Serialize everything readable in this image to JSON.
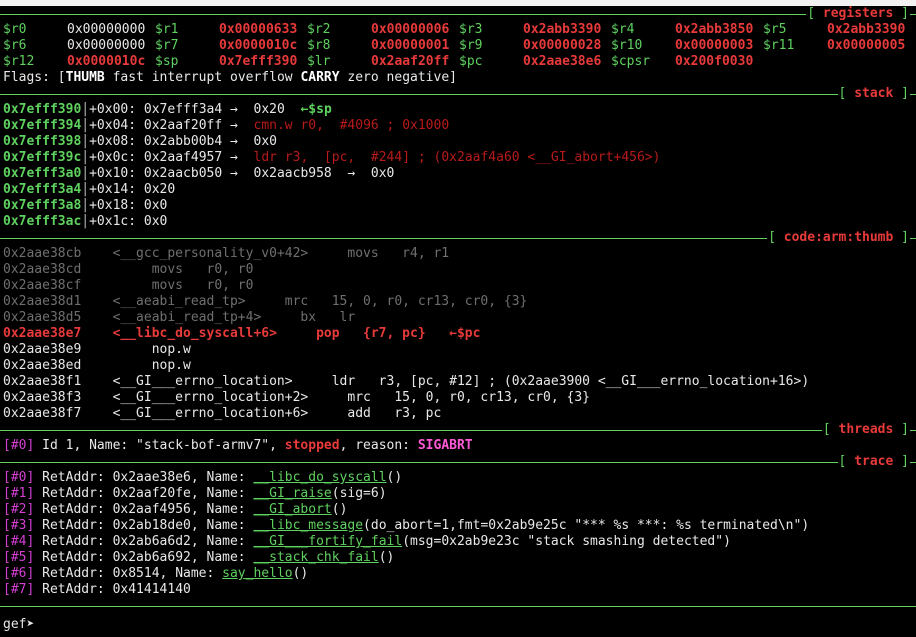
{
  "sections": {
    "registers": "registers",
    "stack": "stack",
    "code": "code:arm:thumb",
    "threads": "threads",
    "trace": "trace"
  },
  "registers": [
    [
      {
        "name": "$r0",
        "value": "0x00000000",
        "changed": false
      },
      {
        "name": "$r1",
        "value": "0x00000633",
        "changed": true
      },
      {
        "name": "$r2",
        "value": "0x00000006",
        "changed": true
      },
      {
        "name": "$r3",
        "value": "0x2abb3390",
        "changed": true
      },
      {
        "name": "$r4",
        "value": "0x2abb3850",
        "changed": true
      },
      {
        "name": "$r5",
        "value": "0x2abb3390",
        "changed": true
      }
    ],
    [
      {
        "name": "$r6",
        "value": "0x00000000",
        "changed": false
      },
      {
        "name": "$r7",
        "value": "0x0000010c",
        "changed": true
      },
      {
        "name": "$r8",
        "value": "0x00000001",
        "changed": true
      },
      {
        "name": "$r9",
        "value": "0x00000028",
        "changed": true
      },
      {
        "name": "$r10",
        "value": "0x00000003",
        "changed": true
      },
      {
        "name": "$r11",
        "value": "0x00000005",
        "changed": true
      }
    ],
    [
      {
        "name": "$r12",
        "value": "0x0000010c",
        "changed": true
      },
      {
        "name": "$sp",
        "value": "0x7efff390",
        "changed": true
      },
      {
        "name": "$lr",
        "value": "0x2aaf20ff",
        "changed": true
      },
      {
        "name": "$pc",
        "value": "0x2aae38e6",
        "changed": true
      },
      {
        "name": "$cpsr",
        "value": "0x200f0030",
        "changed": true
      }
    ]
  ],
  "flags": {
    "prefix": "Flags: [",
    "items": [
      {
        "text": "THUMB",
        "set": true
      },
      {
        "text": " fast interrupt overflow ",
        "set": false
      },
      {
        "text": "CARRY",
        "set": true
      },
      {
        "text": " zero negative",
        "set": false
      }
    ],
    "suffix": "]"
  },
  "stack": [
    {
      "addr": "0x7efff390",
      "offset": "+0x00:",
      "value": "0x7efff3a4",
      "deref": " →  0x20",
      "note": "  ←$sp",
      "noteType": "sp"
    },
    {
      "addr": "0x7efff394",
      "offset": "+0x04:",
      "value": "0x2aaf20ff",
      "deref": " →  ",
      "note": "cmn.w r0,  #4096 ; 0x1000",
      "noteType": "code"
    },
    {
      "addr": "0x7efff398",
      "offset": "+0x08:",
      "value": "0x2abb00b4",
      "deref": " →  0x0",
      "note": "",
      "noteType": ""
    },
    {
      "addr": "0x7efff39c",
      "offset": "+0x0c:",
      "value": "0x2aaf4957",
      "deref": " →  ",
      "note": "ldr r3,  [pc,  #244] ; (0x2aaf4a60 <__GI_abort+456>)",
      "noteType": "code"
    },
    {
      "addr": "0x7efff3a0",
      "offset": "+0x10:",
      "value": "0x2aacb050",
      "deref": " →  0x2aacb958  →  0x0",
      "note": "",
      "noteType": ""
    },
    {
      "addr": "0x7efff3a4",
      "offset": "+0x14:",
      "value": "0x20",
      "deref": "",
      "note": "",
      "noteType": ""
    },
    {
      "addr": "0x7efff3a8",
      "offset": "+0x18:",
      "value": "0x0",
      "deref": "",
      "note": "",
      "noteType": ""
    },
    {
      "addr": "0x7efff3ac",
      "offset": "+0x1c:",
      "value": "0x0",
      "deref": "",
      "note": "",
      "noteType": ""
    }
  ],
  "code": [
    {
      "text": "0x2aae38cb    <__gcc_personality_v0+42>     movs   r4, r1",
      "state": "past"
    },
    {
      "text": "0x2aae38cd         movs   r0, r0",
      "state": "past"
    },
    {
      "text": "0x2aae38cf         movs   r0, r0",
      "state": "past"
    },
    {
      "text": "0x2aae38d1    <__aeabi_read_tp>     mrc   15, 0, r0, cr13, cr0, {3}",
      "state": "past"
    },
    {
      "text": "0x2aae38d5    <__aeabi_read_tp+4>     bx   lr",
      "state": "past"
    },
    {
      "text": "0x2aae38e7    <__libc_do_syscall+6>     pop   {r7, pc}   ←$pc",
      "state": "current"
    },
    {
      "text": "0x2aae38e9         nop.w",
      "state": "next"
    },
    {
      "text": "0x2aae38ed         nop.w",
      "state": "next"
    },
    {
      "text": "0x2aae38f1    <__GI___errno_location>     ldr   r3, [pc, #12] ; (0x2aae3900 <__GI___errno_location+16>)",
      "state": "next"
    },
    {
      "text": "0x2aae38f3    <__GI___errno_location+2>     mrc   15, 0, r0, cr13, cr0, {3}",
      "state": "next"
    },
    {
      "text": "0x2aae38f7    <__GI___errno_location+6>     add   r3, pc",
      "state": "next"
    }
  ],
  "threads": {
    "index": "[#0]",
    "pre": " Id 1, Name: \"stack-bof-armv7\", ",
    "status": "stopped",
    "mid": ", reason: ",
    "reason": "SIGABRT"
  },
  "trace": [
    {
      "idx": "[#0]",
      "ret": " RetAddr: 0x2aae38e6, Name: ",
      "func": "__libc_do_syscall",
      "args": "()"
    },
    {
      "idx": "[#1]",
      "ret": " RetAddr: 0x2aaf20fe, Name: ",
      "func": "__GI_raise",
      "args": "(sig=6)"
    },
    {
      "idx": "[#2]",
      "ret": " RetAddr: 0x2aaf4956, Name: ",
      "func": "__GI_abort",
      "args": "()"
    },
    {
      "idx": "[#3]",
      "ret": " RetAddr: 0x2ab18de0, Name: ",
      "func": "__libc_message",
      "args": "(do_abort=1,fmt=0x2ab9e25c \"*** %s ***: %s terminated\\n\")"
    },
    {
      "idx": "[#4]",
      "ret": " RetAddr: 0x2ab6a6d2, Name: ",
      "func": "__GI___fortify_fail",
      "args": "(msg=0x2ab9e23c \"stack smashing detected\")"
    },
    {
      "idx": "[#5]",
      "ret": " RetAddr: 0x2ab6a692, Name: ",
      "func": "__stack_chk_fail",
      "args": "()"
    },
    {
      "idx": "[#6]",
      "ret": " RetAddr: 0x8514, Name: ",
      "func": "say_hello",
      "args": "()"
    },
    {
      "idx": "[#7]",
      "ret": " RetAddr: 0x41414140",
      "func": "",
      "args": ""
    }
  ],
  "prompt": {
    "text": "gef➤ ",
    "input": ""
  }
}
